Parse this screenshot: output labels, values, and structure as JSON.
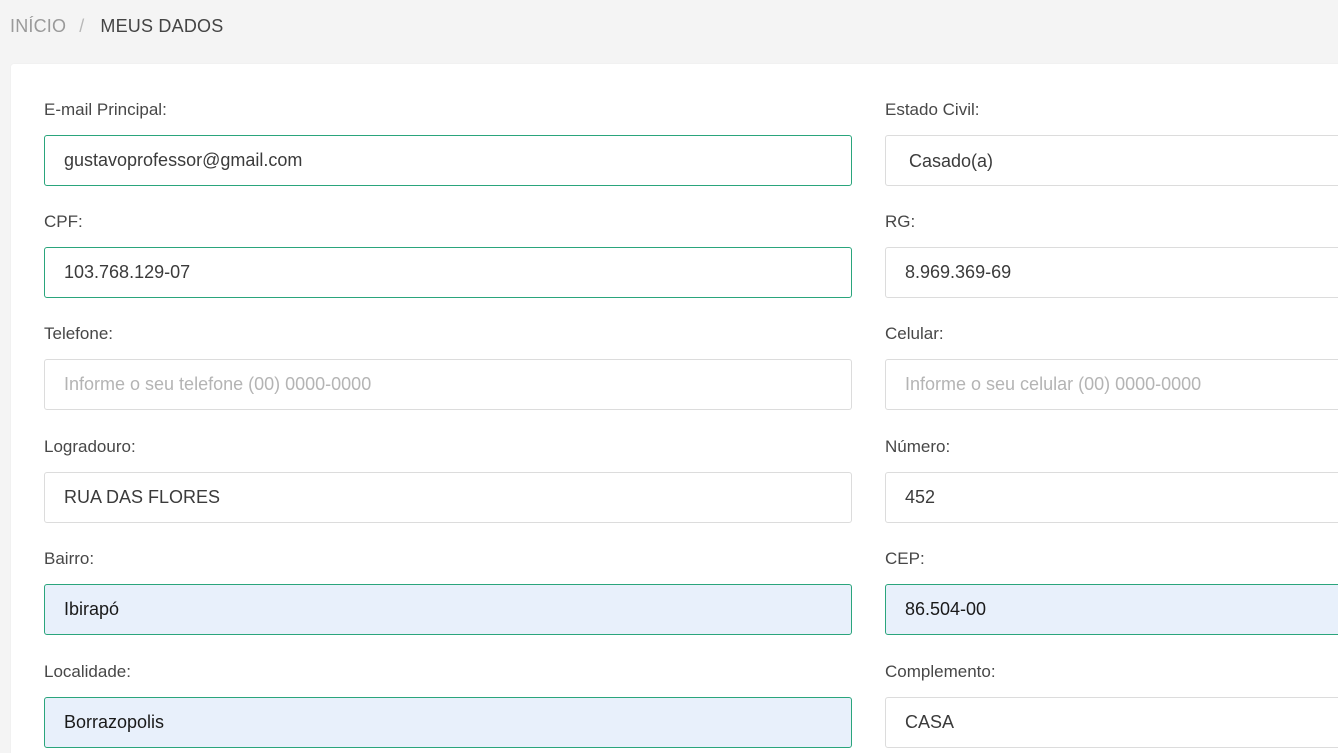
{
  "breadcrumb": {
    "home": "INÍCIO",
    "separator": "/",
    "current": "MEUS DADOS"
  },
  "form": {
    "email": {
      "label": "E-mail Principal:",
      "value": "gustavoprofessor@gmail.com"
    },
    "estado_civil": {
      "label": "Estado Civil:",
      "value": "Casado(a)"
    },
    "cpf": {
      "label": "CPF:",
      "value": "103.768.129-07"
    },
    "rg": {
      "label": "RG:",
      "value": "8.969.369-69"
    },
    "telefone": {
      "label": "Telefone:",
      "value": "",
      "placeholder": "Informe o seu telefone (00) 0000-0000"
    },
    "celular": {
      "label": "Celular:",
      "value": "",
      "placeholder": "Informe o seu celular (00) 0000-0000"
    },
    "logradouro": {
      "label": "Logradouro:",
      "value": "RUA DAS FLORES"
    },
    "numero": {
      "label": "Número:",
      "value": "452"
    },
    "bairro": {
      "label": "Bairro:",
      "value": "Ibirapó"
    },
    "cep": {
      "label": "CEP:",
      "value": "86.504-00"
    },
    "localidade": {
      "label": "Localidade:",
      "value": "Borrazopolis"
    },
    "complemento": {
      "label": "Complemento:",
      "value": "CASA"
    }
  },
  "colors": {
    "valid_border": "#2aa57c",
    "autofill_background": "#e8f0fb",
    "page_background": "#f4f4f4",
    "card_background": "#ffffff"
  }
}
